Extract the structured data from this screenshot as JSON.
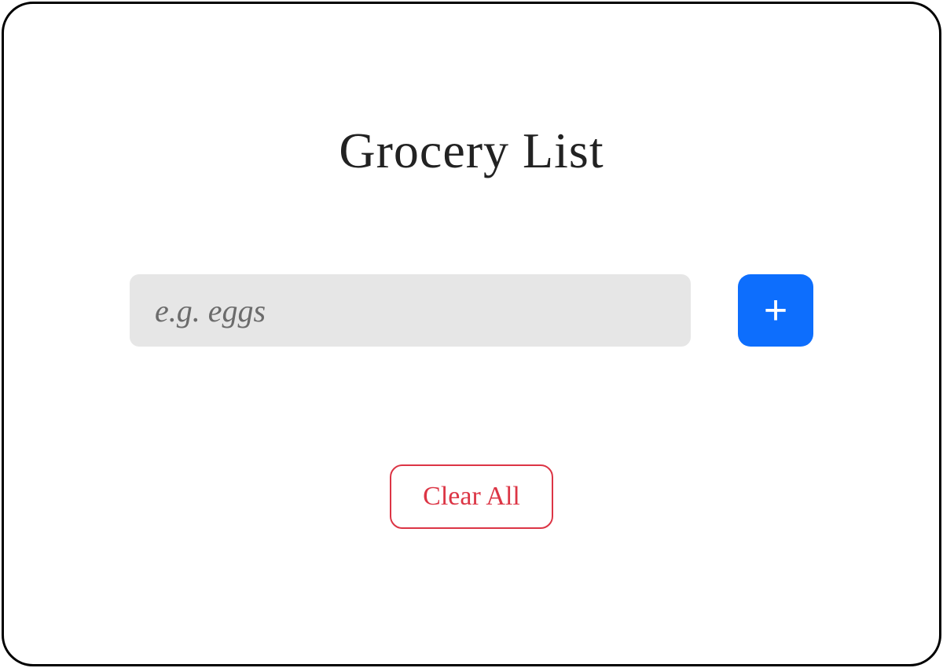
{
  "header": {
    "title": "Grocery List"
  },
  "input": {
    "value": "",
    "placeholder": "e.g. eggs"
  },
  "buttons": {
    "add_label": "+",
    "clear_label": "Clear All"
  },
  "colors": {
    "primary": "#0d6efd",
    "danger": "#dc3545",
    "input_bg": "#e6e6e6"
  }
}
